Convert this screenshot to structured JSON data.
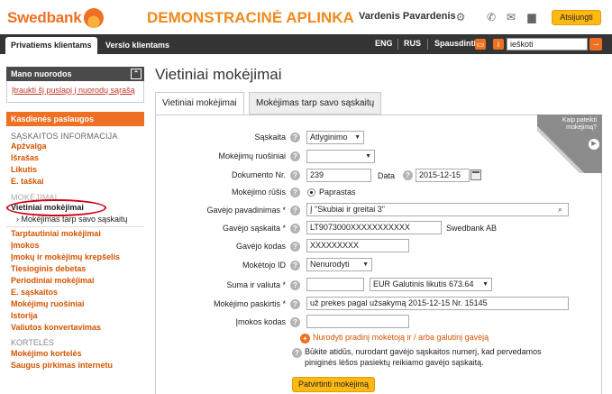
{
  "header": {
    "logo_text": "Swedbank",
    "demo_title": "DEMONSTRACINĖ APLINKA",
    "user_name": "Vardenis Pavardenis",
    "logout_label": "Atsijungti"
  },
  "nav": {
    "tab_private": "Privatiems klientams",
    "tab_business": "Verslo klientams",
    "lang_eng": "ENG",
    "lang_rus": "RUS",
    "print_label": "Spausdinti",
    "search_placeholder": "ieškoti"
  },
  "sidebar": {
    "my_links_title": "Mano nuorodos",
    "add_link_label": "Įtraukti šį puslapį į nuorodų sąrašą",
    "daily_services": "Kasdienės paslaugos",
    "section_account": "SĄSKAITOS INFORMACIJA",
    "account_items": [
      "Apžvalga",
      "Išrašas",
      "Likutis",
      "E. taškai"
    ],
    "section_payments": "MOKĖJIMAI",
    "current_item": "Vietiniai mokėjimai",
    "sub_item": "Mokėjimas tarp savo sąskaitų",
    "payment_items": [
      "Tarptautiniai mokėjimai",
      "Įmokos",
      "Įmokų ir mokėjimų krepšelis",
      "Tiesioginis debetas",
      "Periodiniai mokėjimai",
      "E. sąskaitos",
      "Mokėjimų ruošiniai",
      "Istorija",
      "Valiutos konvertavimas"
    ],
    "section_cards": "KORTELĖS",
    "card_items": [
      "Mokėjimo kortelės",
      "Saugus pirkimas internetu"
    ]
  },
  "main": {
    "page_title": "Vietiniai mokėjimai",
    "tab_local": "Vietiniai mokėjimai",
    "tab_between": "Mokėjimas tarp savo sąskaitų",
    "corner_text": "Kaip pateikti mokėjimą?"
  },
  "form": {
    "account_label": "Sąskaita",
    "account_value": "Atlyginimo",
    "template_label": "Mokėjimų ruošiniai",
    "template_value": "",
    "doc_no_label": "Dokumento Nr.",
    "doc_no_value": "239",
    "date_label": "Data",
    "date_value": "2015-12-15",
    "payment_type_label": "Mokėjimo rūšis",
    "payment_type_value": "Paprastas",
    "payee_name_label": "Gavėjo pavadinimas *",
    "payee_name_value": "Į \"Skubiai ir greitai 3\"",
    "payee_account_label": "Gavėjo sąskaita *",
    "payee_account_value": "LT9073000XXXXXXXXXXX",
    "payee_bank": "Swedbank AB",
    "payee_code_label": "Gavėjo kodas",
    "payee_code_value": "XXXXXXXXX",
    "payer_id_label": "Mokėtojo ID",
    "payer_id_value": "Nenurodyti",
    "amount_label": "Suma ir valiuta *",
    "amount_value": "",
    "currency_value": "EUR Galutinis likutis 673.64",
    "purpose_label": "Mokėjimo paskirtis *",
    "purpose_value": "už prekes pagal užsakymą 2015-12-15 Nr. 15145",
    "payment_code_label": "Įmokos kodas",
    "payment_code_value": "",
    "specify_link": "Nurodyti pradinį mokėtoją ir / arba galutinį gavėją",
    "warning_text": "Būkite atidūs, nurodant gavėjo sąskaitos numerį, kad pervedamos piniginės lėšos pasiektų reikiamo gavėjo sąskaitą.",
    "submit_label": "Patvirtinti mokėjimą"
  },
  "colors": {
    "brand_orange": "#ee7023",
    "button_yellow": "#fdb913",
    "nav_dark": "#353535"
  }
}
